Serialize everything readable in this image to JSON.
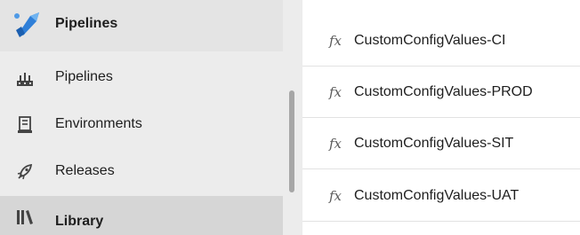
{
  "sidebar": {
    "header": {
      "label": "Pipelines",
      "icon": "azure-pipelines-icon"
    },
    "items": [
      {
        "label": "Pipelines",
        "icon": "pipelines-icon"
      },
      {
        "label": "Environments",
        "icon": "environments-icon"
      },
      {
        "label": "Releases",
        "icon": "releases-icon"
      },
      {
        "label": "Library",
        "icon": "library-icon",
        "selected": true
      }
    ]
  },
  "variable_groups": [
    {
      "label": "CustomConfigValues-CI",
      "icon_glyph": "fx"
    },
    {
      "label": "CustomConfigValues-PROD",
      "icon_glyph": "fx"
    },
    {
      "label": "CustomConfigValues-SIT",
      "icon_glyph": "fx"
    },
    {
      "label": "CustomConfigValues-UAT",
      "icon_glyph": "fx"
    }
  ],
  "colors": {
    "accent_blue": "#2f7fd8",
    "sidebar_bg": "#ececec",
    "selected_bg": "#d6d6d6"
  }
}
